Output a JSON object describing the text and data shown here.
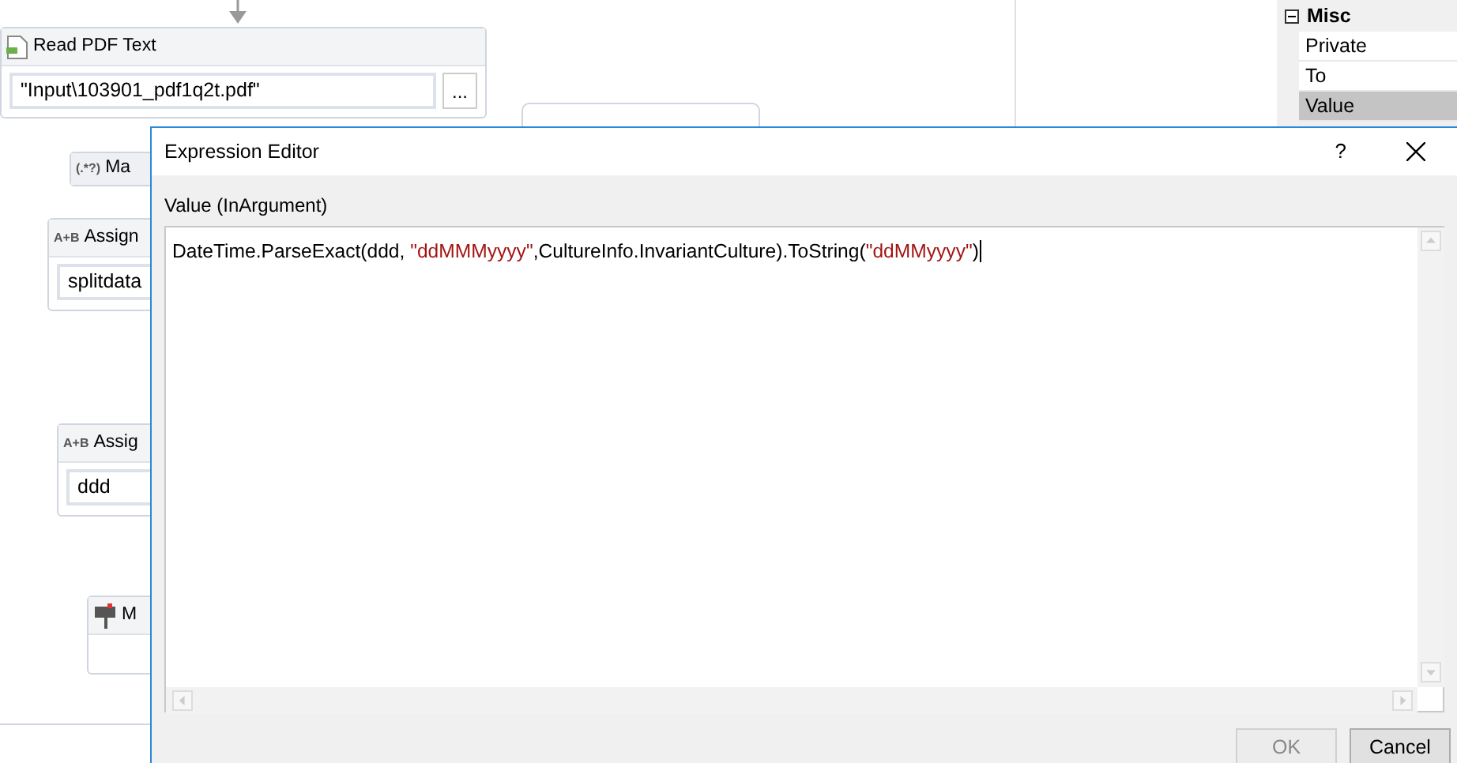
{
  "canvas": {
    "activities": [
      {
        "kind": "file",
        "title": "Read PDF Text",
        "value": "\"Input\\103901_pdf1q2t.pdf\"",
        "button": "..."
      },
      {
        "kind": "regex",
        "icon_text": "(.*?)",
        "title": "Ma"
      },
      {
        "kind": "assign",
        "icon_text": "A+B",
        "title": "Assign",
        "value": "splitdata"
      },
      {
        "kind": "assign",
        "icon_text": "A+B",
        "title": "Assig",
        "value": "ddd"
      },
      {
        "kind": "message",
        "title": "M"
      }
    ]
  },
  "properties": {
    "category": {
      "title": "Misc",
      "expanded": true
    },
    "rows": [
      {
        "label": "Private",
        "selected": false
      },
      {
        "label": "To",
        "selected": false
      },
      {
        "label": "Value",
        "selected": true
      }
    ]
  },
  "dialog": {
    "title": "Expression Editor",
    "help": "?",
    "label": "Value (InArgument)",
    "expression": [
      {
        "kind": "code",
        "text": "DateTime.ParseExact(ddd, "
      },
      {
        "kind": "string",
        "text": "\"ddMMMyyyy\""
      },
      {
        "kind": "code",
        "text": ",CultureInfo.InvariantCulture).ToString("
      },
      {
        "kind": "string",
        "text": "\"ddMMyyyy\""
      },
      {
        "kind": "code",
        "text": ")"
      }
    ],
    "buttons": [
      {
        "label": "OK",
        "disabled": true
      },
      {
        "label": "Cancel",
        "disabled": false
      }
    ]
  }
}
